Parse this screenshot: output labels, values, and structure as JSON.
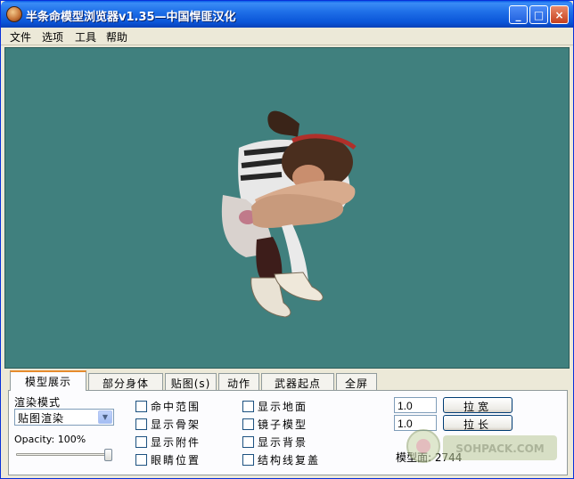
{
  "window": {
    "title": "半条命模型浏览器v1.35—中国悍匪汉化",
    "controls": {
      "minimize": "_",
      "maximize": "□",
      "close": "×"
    }
  },
  "menu": [
    "文件",
    "选项",
    "工具",
    "帮助"
  ],
  "viewport": {
    "background": "#40807e",
    "content": "3D model preview"
  },
  "tabs": [
    "模型展示",
    "部分身体",
    "贴图(s)",
    "动作",
    "武器起点",
    "全屏"
  ],
  "active_tab": "模型展示",
  "render": {
    "mode_label": "渲染模式",
    "mode_value": "贴图渲染",
    "opacity_label": "Opacity: 100%",
    "opacity_percent": 100
  },
  "checks_col1": [
    "命中范围",
    "显示骨架",
    "显示附件",
    "眼睛位置"
  ],
  "checks_col2": [
    "显示地面",
    "镜子模型",
    "显示背景",
    "结构线复盖"
  ],
  "stretch": {
    "width_value": "1.0",
    "width_button": "拉宽",
    "length_value": "1.0",
    "length_button": "拉长"
  },
  "face_count_label": "模型面: 2744",
  "watermark_text": "SOHPACK.COM",
  "colors": {
    "titlebar": "#0a5ee8",
    "accent_tab": "#e68b2c",
    "viewport": "#40807e"
  }
}
